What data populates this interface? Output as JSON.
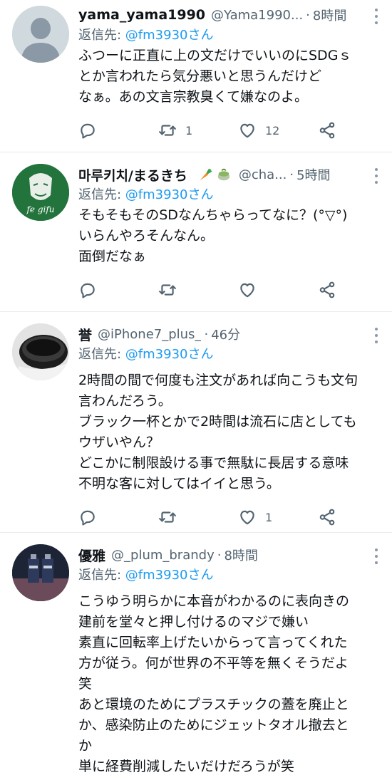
{
  "tweets": [
    {
      "name": "yama_yama1990",
      "handle": "@Yama1990...",
      "time": "8時間",
      "reply_prefix": "返信先: ",
      "reply_to": "@fm3930さん",
      "lines": [
        "ふつーに正直に上の文だけでいいのにSDGｓ",
        "とか言われたら気分悪いと思うんだけど",
        "なぁ。あの文言宗教臭くて嫌なのよ。"
      ],
      "retweets": "1",
      "likes": "12",
      "avatar_icon": "default-person-icon"
    },
    {
      "name": "마루키치/まるきち",
      "handle": "@cha...",
      "time": "5時間",
      "reply_prefix": "返信先: ",
      "reply_to": "@fm3930さん",
      "lines": [
        "そもそもそのSDなんちゃらってなに？(°▽°)",
        "いらんやろそんなん。",
        "面倒だなぁ"
      ],
      "retweets": "",
      "likes": "",
      "avatar_text": "fe gifu",
      "avatar_icon": "mask-avatar-icon"
    },
    {
      "name": "誉",
      "handle": "@iPhone7_plus_",
      "time": "46分",
      "reply_prefix": "返信先: ",
      "reply_to": "@fm3930さん",
      "lines": [
        "2時間の間で何度も注文があれば向こうも文句",
        "言わんだろう。",
        "ブラック一杯とかで2時間は流石に店としても",
        "ウザいやん？",
        "どこかに制限設ける事で無駄に長居する意味",
        "不明な客に対してはイイと思う。"
      ],
      "retweets": "",
      "likes": "1",
      "avatar_icon": "cup-avatar-icon"
    },
    {
      "name": "優雅",
      "handle": "@_plum_brandy",
      "time": "8時間",
      "reply_prefix": "返信先: ",
      "reply_to": "@fm3930さん",
      "lines": [
        "こうゆう明らかに本音がわかるのに表向きの",
        "建前を堂々と押し付けるのマジで嫌い",
        "素直に回転率上げたいからって言ってくれた",
        "方が従う。何が世界の不平等を無くそうだよ",
        "笑",
        "あと環境のためにプラスチックの蓋を廃止と",
        "か、感染防止のためにジェットタオル撤去と",
        "か",
        "単に経費削減したいだけだろうが笑"
      ],
      "avatar_icon": "bottles-avatar-icon"
    }
  ],
  "colors": {
    "mention": "#1d9bf0",
    "secondary": "#536471",
    "divider": "#e6ecf0"
  }
}
